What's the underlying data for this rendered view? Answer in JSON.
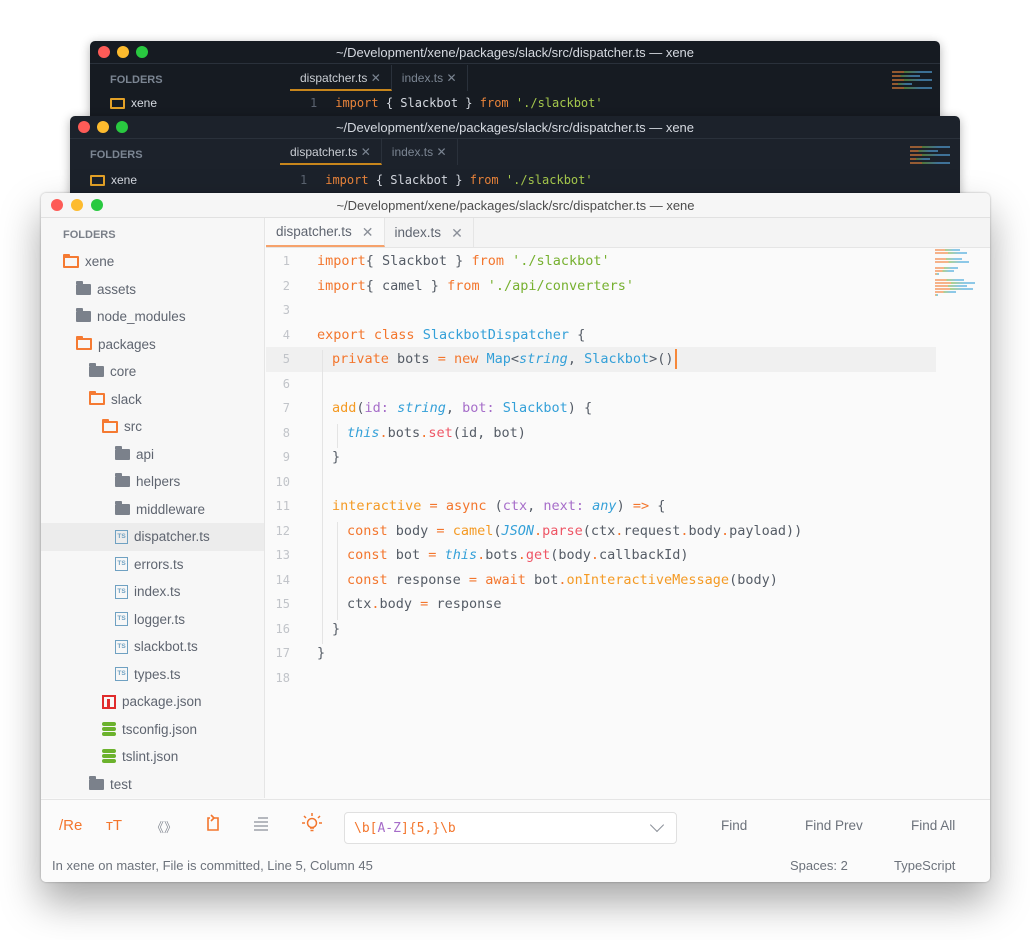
{
  "window_title": "~/Development/xene/packages/slack/src/dispatcher.ts — xene",
  "background_windows": [
    {
      "title": "~/Development/xene/packages/slack/src/dispatcher.ts — xene",
      "sidebar_header": "FOLDERS",
      "root_folder": "xene",
      "tabs": [
        "dispatcher.ts",
        "index.ts"
      ],
      "first_line_number": "1"
    },
    {
      "title": "~/Development/xene/packages/slack/src/dispatcher.ts — xene",
      "sidebar_header": "FOLDERS",
      "root_folder": "xene",
      "tabs": [
        "dispatcher.ts",
        "index.ts"
      ],
      "first_line_number": "1"
    }
  ],
  "sidebar": {
    "header": "FOLDERS",
    "items": [
      {
        "label": "xene",
        "icon": "folder-open",
        "depth": 0
      },
      {
        "label": "assets",
        "icon": "folder-closed",
        "depth": 1
      },
      {
        "label": "node_modules",
        "icon": "folder-closed",
        "depth": 1
      },
      {
        "label": "packages",
        "icon": "folder-open",
        "depth": 1
      },
      {
        "label": "core",
        "icon": "folder-closed",
        "depth": 2
      },
      {
        "label": "slack",
        "icon": "folder-open",
        "depth": 2
      },
      {
        "label": "src",
        "icon": "folder-open",
        "depth": 3
      },
      {
        "label": "api",
        "icon": "folder-closed",
        "depth": 4
      },
      {
        "label": "helpers",
        "icon": "folder-closed",
        "depth": 4
      },
      {
        "label": "middleware",
        "icon": "folder-closed",
        "depth": 4
      },
      {
        "label": "dispatcher.ts",
        "icon": "ts-file",
        "depth": 4,
        "selected": true
      },
      {
        "label": "errors.ts",
        "icon": "ts-file",
        "depth": 4
      },
      {
        "label": "index.ts",
        "icon": "ts-file",
        "depth": 4
      },
      {
        "label": "logger.ts",
        "icon": "ts-file",
        "depth": 4
      },
      {
        "label": "slackbot.ts",
        "icon": "ts-file",
        "depth": 4
      },
      {
        "label": "types.ts",
        "icon": "ts-file",
        "depth": 4
      },
      {
        "label": "package.json",
        "icon": "npm-file",
        "depth": 3
      },
      {
        "label": "tsconfig.json",
        "icon": "json-file",
        "depth": 3
      },
      {
        "label": "tslint.json",
        "icon": "json-file",
        "depth": 3
      },
      {
        "label": "test",
        "icon": "folder-closed",
        "depth": 2
      }
    ]
  },
  "tabs": [
    {
      "label": "dispatcher.ts",
      "active": true
    },
    {
      "label": "index.ts",
      "active": false
    }
  ],
  "editor": {
    "current_line": 5,
    "lines": [
      {
        "n": "1",
        "indent": 0,
        "tokens": [
          [
            "k",
            "import"
          ],
          [
            "",
            "{ Slackbot } "
          ],
          [
            "k",
            "from"
          ],
          [
            "",
            " "
          ],
          [
            "s",
            "'./slackbot'"
          ]
        ]
      },
      {
        "n": "2",
        "indent": 0,
        "tokens": [
          [
            "k",
            "import"
          ],
          [
            "",
            "{ camel } "
          ],
          [
            "k",
            "from"
          ],
          [
            "",
            " "
          ],
          [
            "s",
            "'./api/converters'"
          ]
        ]
      },
      {
        "n": "3",
        "indent": 0,
        "tokens": []
      },
      {
        "n": "4",
        "indent": 0,
        "tokens": [
          [
            "k",
            "export"
          ],
          [
            "",
            " "
          ],
          [
            "k",
            "class"
          ],
          [
            "",
            " "
          ],
          [
            "t",
            "SlackbotDispatcher"
          ],
          [
            "",
            " {"
          ]
        ]
      },
      {
        "n": "5",
        "indent": 1,
        "tokens": [
          [
            "k",
            "private"
          ],
          [
            "",
            " bots "
          ],
          [
            "o",
            "="
          ],
          [
            "",
            " "
          ],
          [
            "o",
            "new"
          ],
          [
            "",
            " "
          ],
          [
            "t",
            "Map"
          ],
          [
            "",
            "<"
          ],
          [
            "ti",
            "string"
          ],
          [
            "",
            ", "
          ],
          [
            "t",
            "Slackbot"
          ],
          [
            "",
            ">()"
          ]
        ]
      },
      {
        "n": "6",
        "indent": 1,
        "tokens": []
      },
      {
        "n": "7",
        "indent": 1,
        "tokens": [
          [
            "f",
            "add"
          ],
          [
            "",
            "("
          ],
          [
            "p",
            "id"
          ],
          [
            "p",
            ": "
          ],
          [
            "ti",
            "string"
          ],
          [
            "",
            ", "
          ],
          [
            "p",
            "bot"
          ],
          [
            "p",
            ": "
          ],
          [
            "t",
            "Slackbot"
          ],
          [
            "",
            ") {"
          ]
        ]
      },
      {
        "n": "8",
        "indent": 2,
        "tokens": [
          [
            "ti",
            "this"
          ],
          [
            "d",
            "."
          ],
          [
            "",
            "bots"
          ],
          [
            "d",
            "."
          ],
          [
            "m",
            "set"
          ],
          [
            "",
            "(id, bot)"
          ]
        ]
      },
      {
        "n": "9",
        "indent": 1,
        "tokens": [
          [
            "",
            "}"
          ]
        ]
      },
      {
        "n": "10",
        "indent": 1,
        "tokens": []
      },
      {
        "n": "11",
        "indent": 1,
        "tokens": [
          [
            "f",
            "interactive"
          ],
          [
            "",
            " "
          ],
          [
            "o",
            "="
          ],
          [
            "",
            " "
          ],
          [
            "k",
            "async"
          ],
          [
            "",
            " ("
          ],
          [
            "p",
            "ctx"
          ],
          [
            "",
            ", "
          ],
          [
            "p",
            "next"
          ],
          [
            "p",
            ": "
          ],
          [
            "ti",
            "any"
          ],
          [
            "",
            ") "
          ],
          [
            "o",
            "=>"
          ],
          [
            "",
            " {"
          ]
        ]
      },
      {
        "n": "12",
        "indent": 2,
        "tokens": [
          [
            "k",
            "const"
          ],
          [
            "",
            " body "
          ],
          [
            "o",
            "="
          ],
          [
            "",
            " "
          ],
          [
            "f",
            "camel"
          ],
          [
            "",
            "("
          ],
          [
            "ti",
            "JSON"
          ],
          [
            "d",
            "."
          ],
          [
            "m",
            "parse"
          ],
          [
            "",
            "(ctx"
          ],
          [
            "d",
            "."
          ],
          [
            "",
            "request"
          ],
          [
            "d",
            "."
          ],
          [
            "",
            "body"
          ],
          [
            "d",
            "."
          ],
          [
            "",
            "payload))"
          ]
        ]
      },
      {
        "n": "13",
        "indent": 2,
        "tokens": [
          [
            "k",
            "const"
          ],
          [
            "",
            " bot "
          ],
          [
            "o",
            "="
          ],
          [
            "",
            " "
          ],
          [
            "ti",
            "this"
          ],
          [
            "d",
            "."
          ],
          [
            "",
            "bots"
          ],
          [
            "d",
            "."
          ],
          [
            "m",
            "get"
          ],
          [
            "",
            "(body"
          ],
          [
            "d",
            "."
          ],
          [
            "",
            "callbackId)"
          ]
        ]
      },
      {
        "n": "14",
        "indent": 2,
        "tokens": [
          [
            "k",
            "const"
          ],
          [
            "",
            " response "
          ],
          [
            "o",
            "="
          ],
          [
            "",
            " "
          ],
          [
            "k",
            "await"
          ],
          [
            "",
            " bot"
          ],
          [
            "d",
            "."
          ],
          [
            "f",
            "onInteractiveMessage"
          ],
          [
            "",
            "(body)"
          ]
        ]
      },
      {
        "n": "15",
        "indent": 2,
        "tokens": [
          [
            "",
            "ctx"
          ],
          [
            "d",
            "."
          ],
          [
            "",
            "body "
          ],
          [
            "o",
            "="
          ],
          [
            "",
            " response"
          ]
        ]
      },
      {
        "n": "16",
        "indent": 1,
        "tokens": [
          [
            "",
            "}"
          ]
        ]
      },
      {
        "n": "17",
        "indent": 0,
        "tokens": [
          [
            "",
            "}"
          ]
        ]
      },
      {
        "n": "18",
        "indent": 0,
        "tokens": []
      }
    ]
  },
  "findbar": {
    "regex_label": "/Re",
    "case_label": "тT",
    "whole_word_label": "《》",
    "query": "\\b[A-Z]{5,}\\b",
    "find_label": "Find",
    "find_prev_label": "Find Prev",
    "find_all_label": "Find All"
  },
  "statusbar": {
    "left": "In xene on master, File is committed, Line 5, Column 45",
    "indent": "Spaces: 2",
    "syntax": "TypeScript"
  },
  "colors": {
    "accent": "#f3762d",
    "string": "#76b02f",
    "type": "#34a0d8",
    "param": "#a66dc9",
    "method": "#ee5565"
  }
}
